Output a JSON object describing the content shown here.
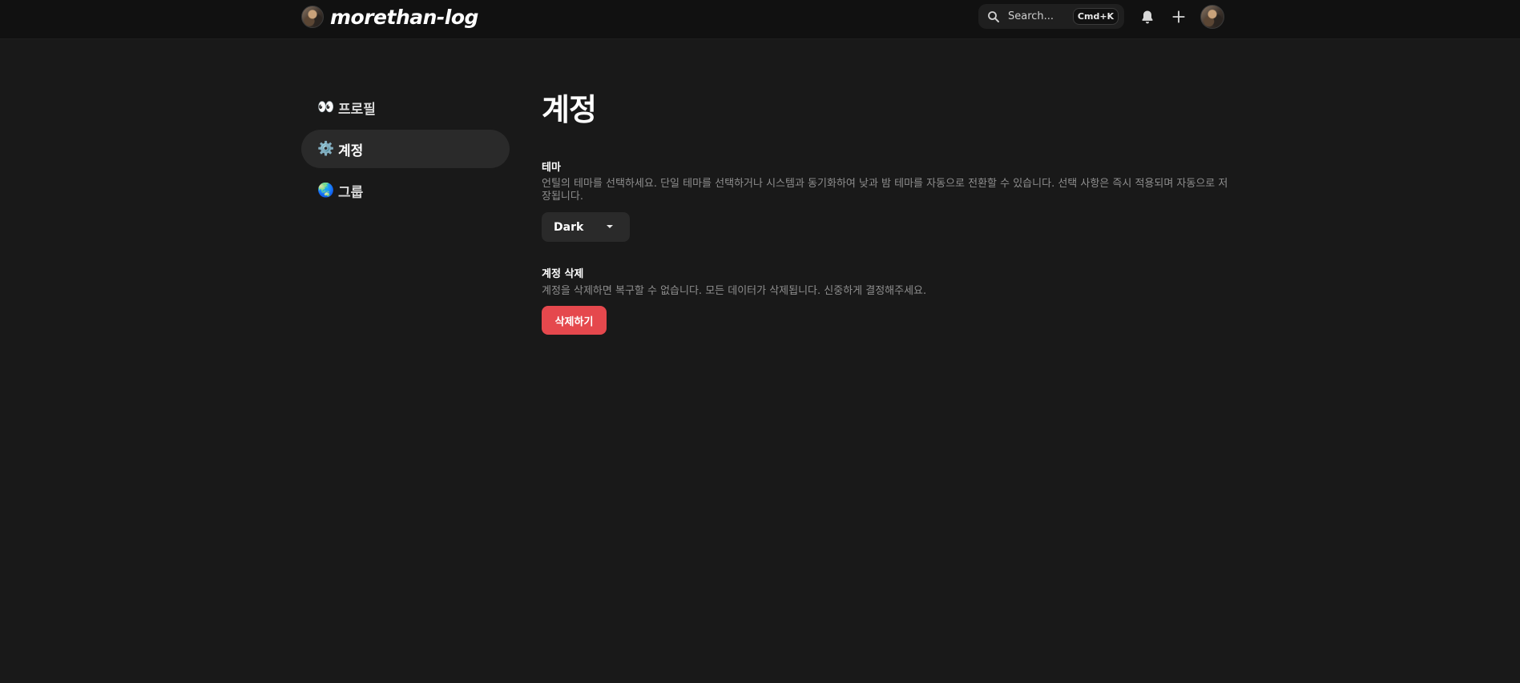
{
  "header": {
    "brand_title": "morethan-log",
    "search_placeholder": "Search...",
    "search_shortcut": "Cmd+K"
  },
  "sidebar": {
    "items": [
      {
        "emoji": "👀",
        "label": "프로필",
        "active": false
      },
      {
        "emoji": "⚙️",
        "label": "계정",
        "active": true
      },
      {
        "emoji": "🌏",
        "label": "그룹",
        "active": false
      }
    ]
  },
  "main": {
    "title": "계정",
    "theme": {
      "title": "테마",
      "description": "언틸의 테마를 선택하세요. 단일 테마를 선택하거나 시스템과 동기화하여 낮과 밤 테마를 자동으로 전환할 수 있습니다. 선택 사항은 즉시 적용되며 자동으로 저장됩니다.",
      "selected": "Dark"
    },
    "delete_account": {
      "title": "계정 삭제",
      "description": "계정을 삭제하면 복구할 수 없습니다. 모든 데이터가 삭제됩니다. 신중하게 결정해주세요.",
      "button_label": "삭제하기"
    }
  },
  "colors": {
    "background": "#191919",
    "header": "#111111",
    "danger": "#e5484d"
  }
}
